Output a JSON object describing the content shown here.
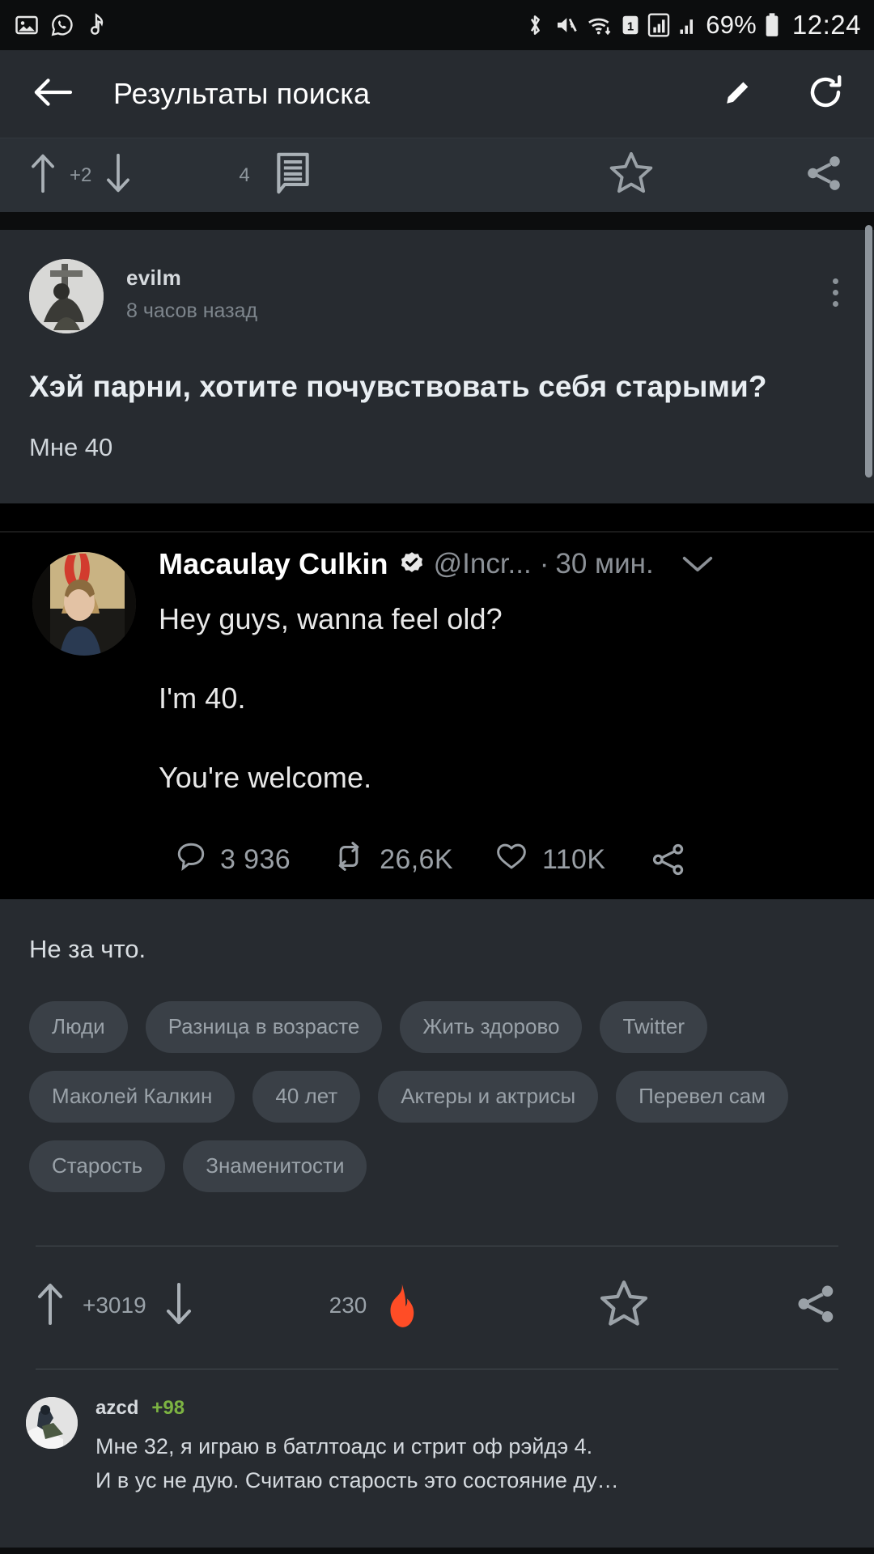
{
  "statusbar": {
    "left_icons": [
      "image-icon",
      "whatsapp-icon",
      "music-note-icon"
    ],
    "right_icons": [
      "bluetooth-icon",
      "volume-mute-icon",
      "wifi-icon",
      "sim1-icon",
      "signal-bars-icon",
      "signal-bars-2-icon"
    ],
    "battery_percent": "69%",
    "time": "12:24"
  },
  "appbar": {
    "back_label": "back-arrow",
    "title": "Результаты поиска",
    "edit_label": "edit",
    "refresh_label": "refresh"
  },
  "top_toolbar": {
    "upvote_count": "+2",
    "comments_count": "4",
    "star_label": "star",
    "share_label": "share"
  },
  "post": {
    "author": "evilm",
    "time": "8 часов назад",
    "title": "Хэй парни, хотите почувствовать себя старыми?",
    "subtitle": "Мне 40",
    "after_image_text": "Не за что."
  },
  "tweet": {
    "display_name": "Macaulay Culkin",
    "verified": true,
    "handle": "@Incr...",
    "separator": "·",
    "time": "30 мин.",
    "line1": "Hey guys, wanna feel old?",
    "line2": "I'm 40.",
    "line3": "You're welcome.",
    "stats": {
      "replies": "3 936",
      "retweets": "26,6K",
      "likes": "110K"
    }
  },
  "tags": [
    "Люди",
    "Разница в возрасте",
    "Жить здорово",
    "Twitter",
    "Маколей Калкин",
    "40 лет",
    "Актеры и актрисы",
    "Перевел сам",
    "Старость",
    "Знаменитости"
  ],
  "actionbar": {
    "rating": "+3019",
    "comments_count": "230",
    "hot_icon": "flame-icon",
    "star_label": "star",
    "share_label": "share"
  },
  "comment": {
    "author": "azcd",
    "score": "+98",
    "line1": "Мне 32, я играю в батлтоадс и стрит оф рэйдэ 4.",
    "line2": "И в ус не дую. Считаю старость это состояние ду…"
  },
  "colors": {
    "background": "#272b30",
    "tweet_background": "#000000",
    "accent_flame": "#ff4d26",
    "score_green": "#7cb342",
    "tag_background": "#3a4047"
  }
}
